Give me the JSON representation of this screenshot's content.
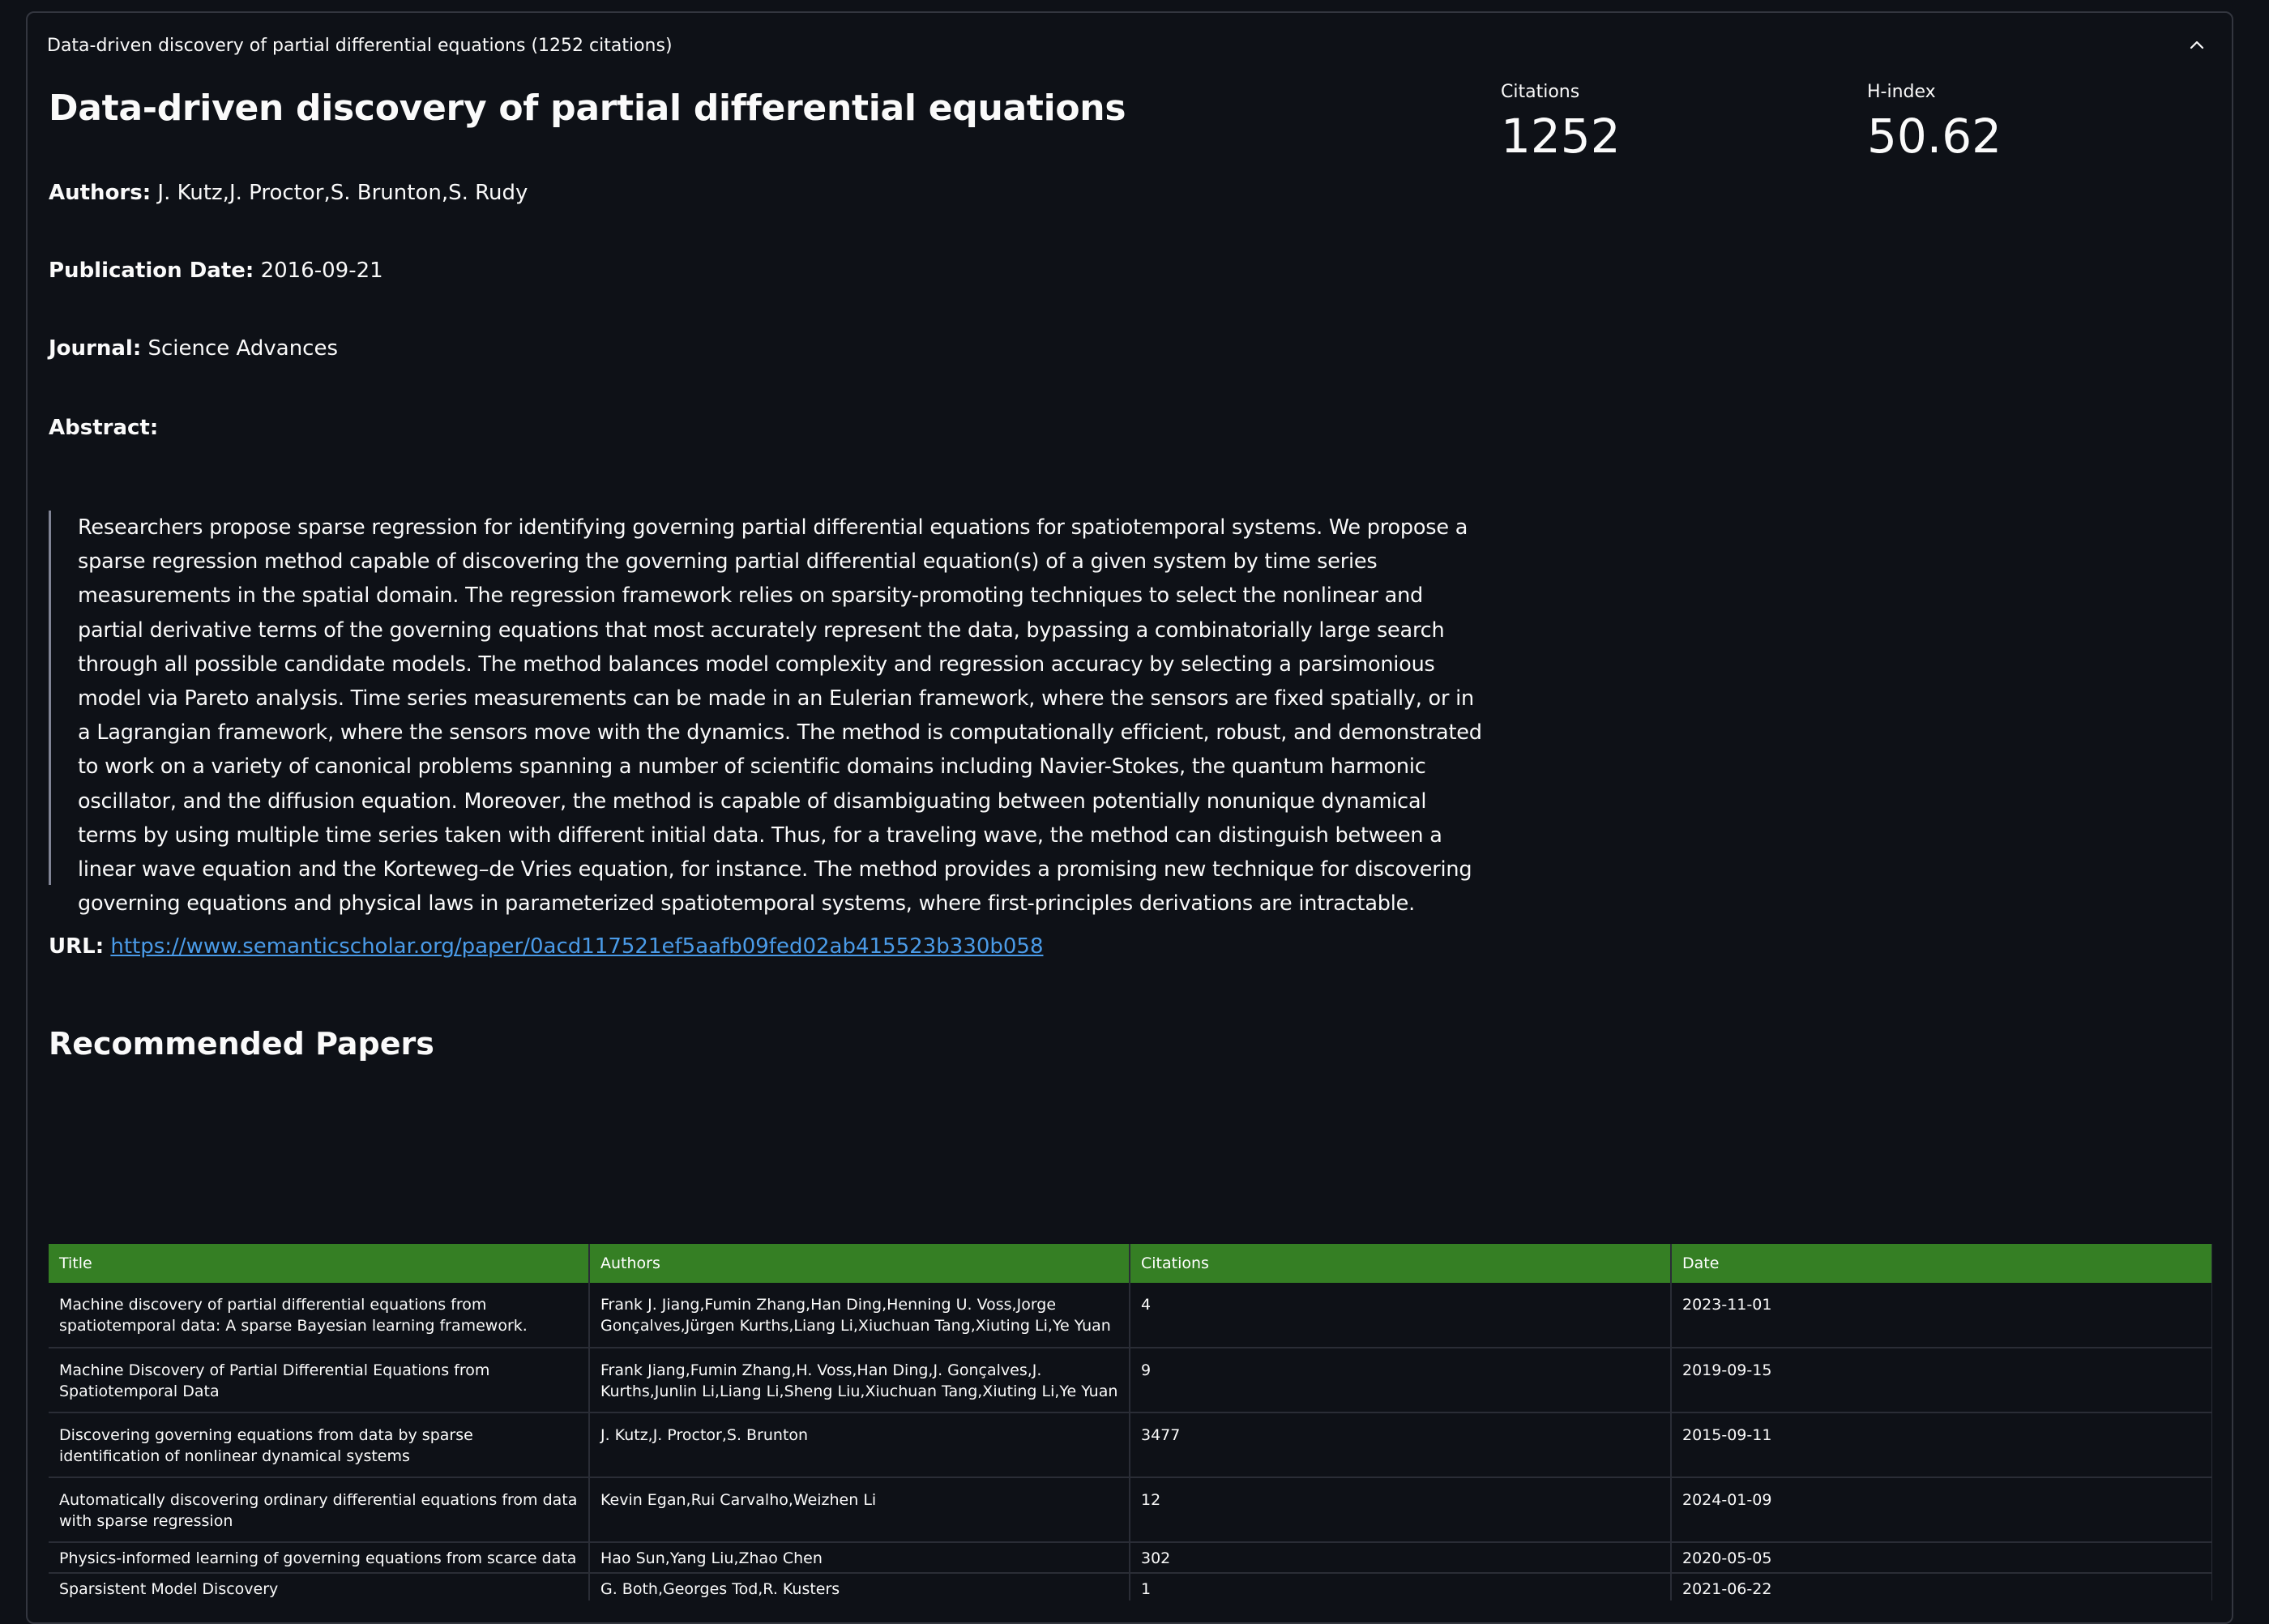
{
  "expander": {
    "header": "Data-driven discovery of partial differential equations (1252 citations)"
  },
  "paper": {
    "title": "Data-driven discovery of partial differential equations",
    "authors_label": "Authors:",
    "authors": "J. Kutz,J. Proctor,S. Brunton,S. Rudy",
    "date_label": "Publication Date:",
    "date": "2016-09-21",
    "journal_label": "Journal:",
    "journal": "Science Advances",
    "abstract_label": "Abstract:",
    "abstract": "Researchers propose sparse regression for identifying governing partial differential equations for spatiotemporal systems. We propose a sparse regression method capable of discovering the governing partial differential equation(s) of a given system by time series measurements in the spatial domain. The regression framework relies on sparsity-promoting techniques to select the nonlinear and partial derivative terms of the governing equations that most accurately represent the data, bypassing a combinatorially large search through all possible candidate models. The method balances model complexity and regression accuracy by selecting a parsimonious model via Pareto analysis. Time series measurements can be made in an Eulerian framework, where the sensors are fixed spatially, or in a Lagrangian framework, where the sensors move with the dynamics. The method is computationally efficient, robust, and demonstrated to work on a variety of canonical problems spanning a number of scientific domains including Navier-Stokes, the quantum harmonic oscillator, and the diffusion equation. Moreover, the method is capable of disambiguating between potentially nonunique dynamical terms by using multiple time series taken with different initial data. Thus, for a traveling wave, the method can distinguish between a linear wave equation and the Korteweg–de Vries equation, for instance. The method provides a promising new technique for discovering governing equations and physical laws in parameterized spatiotemporal systems, where first-principles derivations are intractable.",
    "url_label": "URL:",
    "url": "https://www.semanticscholar.org/paper/0acd117521ef5aafb09fed02ab415523b330b058"
  },
  "metrics": {
    "citations_label": "Citations",
    "citations_value": "1252",
    "hindex_label": "H-index",
    "hindex_value": "50.62"
  },
  "recommended": {
    "heading": "Recommended Papers",
    "columns": [
      "Title",
      "Authors",
      "Citations",
      "Date"
    ],
    "rows": [
      [
        "Machine discovery of partial differential equations from spatiotemporal data: A sparse Bayesian learning framework.",
        "Frank J. Jiang,Fumin Zhang,Han Ding,Henning U. Voss,Jorge Gonçalves,Jürgen Kurths,Liang Li,Xiuchuan Tang,Xiuting Li,Ye Yuan",
        "4",
        "2023-11-01"
      ],
      [
        "Machine Discovery of Partial Differential Equations from Spatiotemporal Data",
        "Frank Jiang,Fumin Zhang,H. Voss,Han Ding,J. Gonçalves,J. Kurths,Junlin Li,Liang Li,Sheng Liu,Xiuchuan Tang,Xiuting Li,Ye Yuan",
        "9",
        "2019-09-15"
      ],
      [
        "Discovering governing equations from data by sparse identification of nonlinear dynamical systems",
        "J. Kutz,J. Proctor,S. Brunton",
        "3477",
        "2015-09-11"
      ],
      [
        "Automatically discovering ordinary differential equations from data with sparse regression",
        "Kevin Egan,Rui Carvalho,Weizhen Li",
        "12",
        "2024-01-09"
      ],
      [
        "Physics-informed learning of governing equations from scarce data",
        "Hao Sun,Yang Liu,Zhao Chen",
        "302",
        "2020-05-05"
      ],
      [
        "Sparsistent Model Discovery",
        "G. Both,Georges Tod,R. Kusters",
        "1",
        "2021-06-22"
      ]
    ]
  }
}
